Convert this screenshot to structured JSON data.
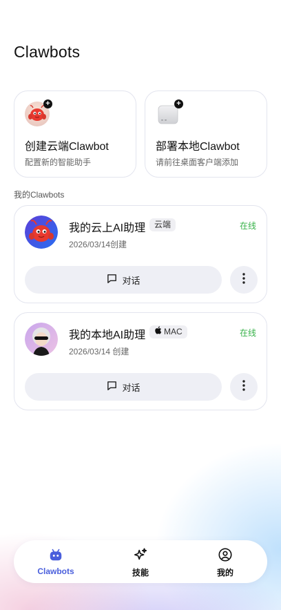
{
  "header": {
    "title": "Clawbots"
  },
  "actions": [
    {
      "title": "创建云端Clawbot",
      "subtitle": "配置新的智能助手",
      "icon": "red-lobster-avatar-icon"
    },
    {
      "title": "部署本地Clawbot",
      "subtitle": "请前往桌面客户端添加",
      "icon": "mac-mini-device-icon"
    }
  ],
  "section": {
    "label": "我的Clawbots"
  },
  "bots": [
    {
      "name": "我的云上AI助理",
      "tag": "云端",
      "status": "在线",
      "date": "2026/03/14创建",
      "chat_label": "对话",
      "avatar": "red-lobster-avatar-icon"
    },
    {
      "name": "我的本地AI助理",
      "tag": "MAC",
      "tag_icon": "apple-icon",
      "status": "在线",
      "date": "2026/03/14 创建",
      "chat_label": "对话",
      "avatar": "sunglasses-character-avatar-icon"
    }
  ],
  "tabbar": {
    "items": [
      {
        "label": "Clawbots",
        "icon": "robot-icon",
        "active": true
      },
      {
        "label": "技能",
        "icon": "sparkles-icon",
        "active": false
      },
      {
        "label": "我的",
        "icon": "user-circle-icon",
        "active": false
      }
    ]
  },
  "colors": {
    "accent": "#4a5fdc",
    "online": "#38b24a",
    "button_bg": "#eeeff5"
  }
}
